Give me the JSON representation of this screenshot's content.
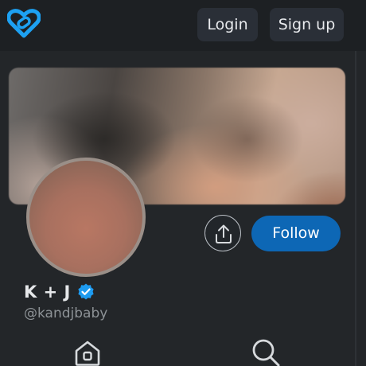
{
  "header": {
    "logo_icon": "heart-link-logo-icon",
    "login_label": "Login",
    "signup_label": "Sign up"
  },
  "profile": {
    "banner": "blurred-banner-image",
    "avatar": "blurred-avatar-image",
    "display_name": "K + J",
    "verified_icon": "verified-badge-icon",
    "handle": "@kandjbaby",
    "share_icon": "share-upload-icon",
    "follow_label": "Follow"
  },
  "nav": {
    "items": [
      {
        "icon": "home-icon"
      },
      {
        "icon": "search-icon"
      }
    ]
  },
  "colors": {
    "background": "#232629",
    "topbar": "#1d2023",
    "header_button": "#2a2f37",
    "accent": "#0d67b5",
    "logo": "#1da1f2",
    "verified": "#1d9bf0",
    "text_primary": "#e6e8ea",
    "text_secondary": "#8d9296"
  }
}
